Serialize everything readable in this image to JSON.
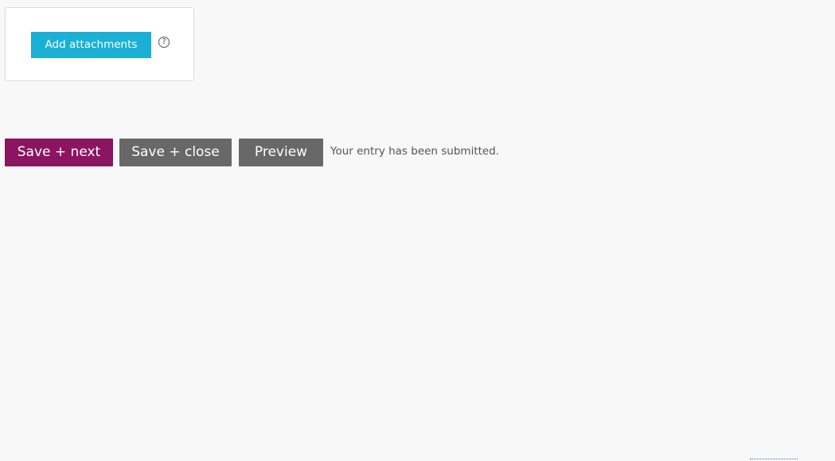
{
  "attachments": {
    "add_label": "Add attachments",
    "help_glyph": "?"
  },
  "actions": {
    "save_next_label": "Save + next",
    "save_close_label": "Save + close",
    "preview_label": "Preview"
  },
  "status": {
    "message": "Your entry has been submitted."
  },
  "colors": {
    "background": "#f8f8f8",
    "accent_attach": "#1ab0d5",
    "primary_action": "#8b1560",
    "secondary_action": "#686868"
  }
}
